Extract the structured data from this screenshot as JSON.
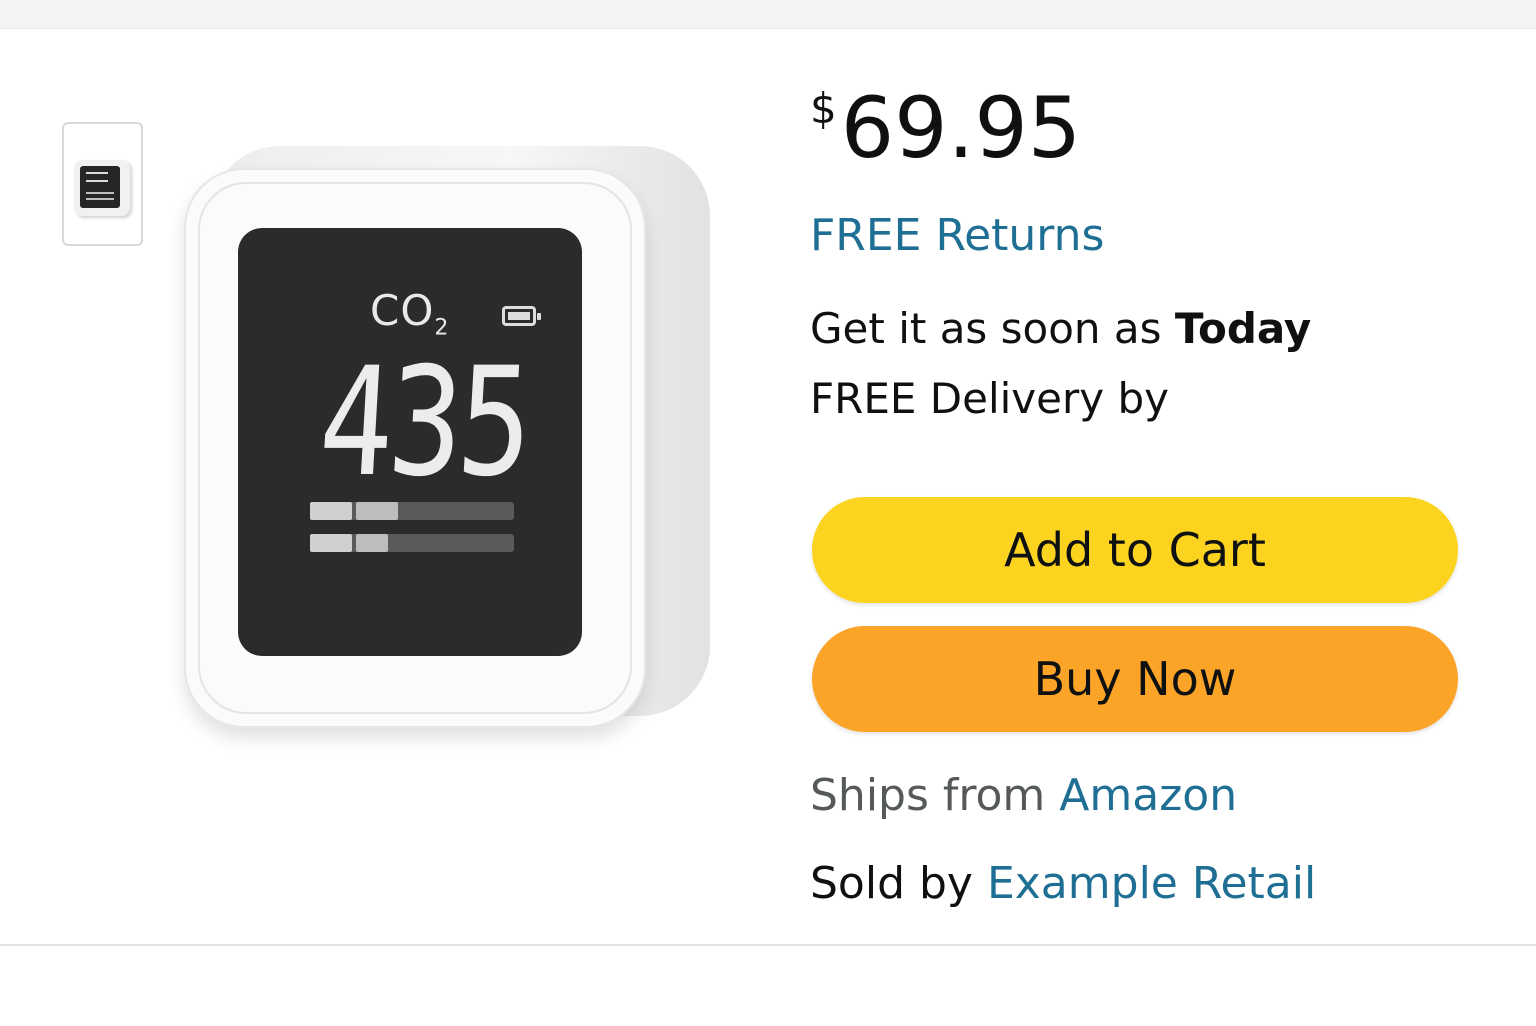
{
  "product": {
    "image_alt": "CO2 monitor",
    "display": {
      "gas_label": "CO",
      "gas_subscript": "2",
      "reading": "435"
    }
  },
  "offer": {
    "currency_symbol": "$",
    "price": "69.95",
    "free_returns": "FREE Returns",
    "delivery_prefix": "Get it as soon as",
    "delivery_day": "Today",
    "delivery_line2": "FREE Delivery by"
  },
  "actions": {
    "add_to_cart": "Add to Cart",
    "buy_now": "Buy Now"
  },
  "seller": {
    "ships_from_label": "Ships from",
    "ships_from_value": "Amazon",
    "sold_by_label": "Sold by",
    "sold_by_value": "Example Retail"
  },
  "colors": {
    "add_to_cart": "#fcd41f",
    "buy_now": "#fca428",
    "link": "#1f6f95",
    "text": "#0f1111"
  }
}
